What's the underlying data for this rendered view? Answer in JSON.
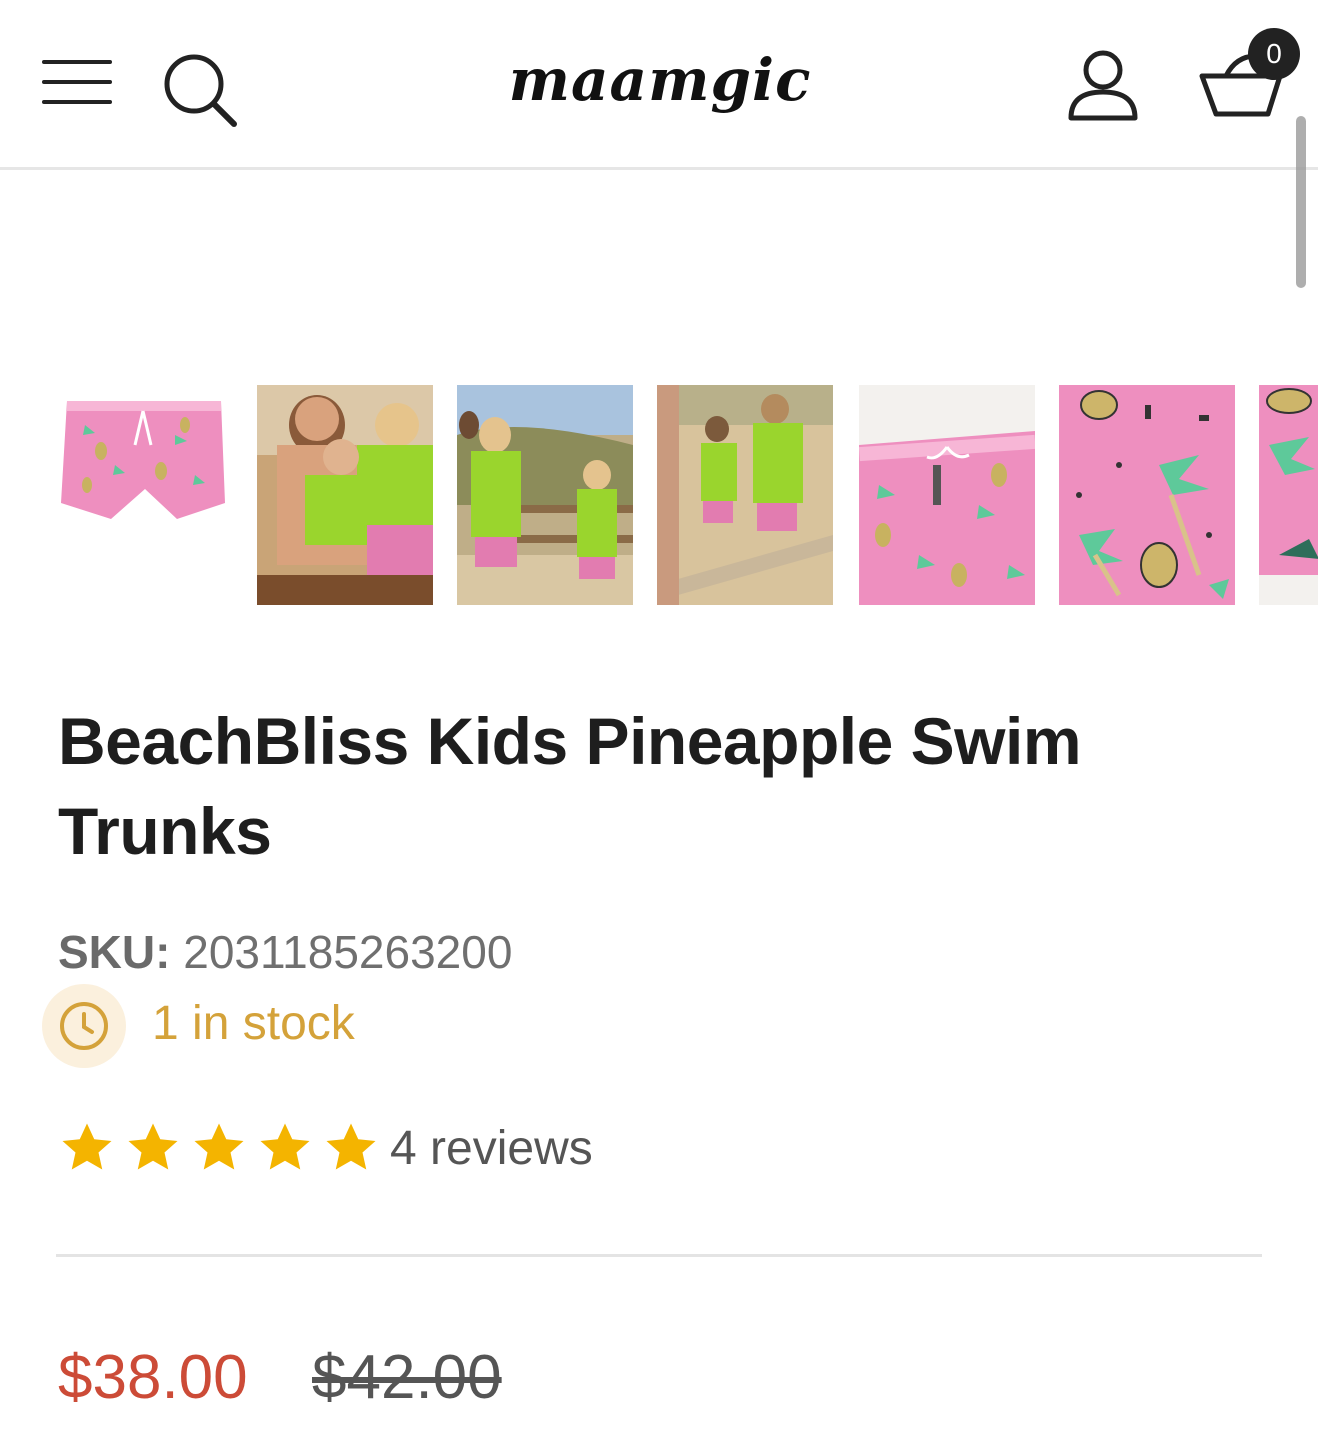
{
  "header": {
    "logo_text": "maamgic",
    "cart_count": "0",
    "icons": [
      "menu-icon",
      "search-icon",
      "account-icon",
      "cart-icon"
    ]
  },
  "gallery": {
    "thumbnails": [
      {
        "alt": "product-front"
      },
      {
        "alt": "lifestyle-family"
      },
      {
        "alt": "lifestyle-kids-walk"
      },
      {
        "alt": "lifestyle-kids-back"
      },
      {
        "alt": "detail-waistband"
      },
      {
        "alt": "detail-print"
      },
      {
        "alt": "detail-edge"
      }
    ]
  },
  "product": {
    "title": "BeachBliss Kids Pineapple Swim Trunks",
    "sku_label": "SKU:",
    "sku_value": "2031185263200",
    "stock_text": "1 in stock",
    "rating": 5,
    "rating_max": 5,
    "reviews_text": "4 reviews",
    "price_sale": "$38.00",
    "price_original": "$42.00"
  },
  "colors": {
    "sale": "#cc4b37",
    "stock": "#d4a23a",
    "star": "#f4b400",
    "print_pink": "#ee8fbf",
    "palm_green": "#5ec99a",
    "hoodie_green": "#9ad52d"
  }
}
